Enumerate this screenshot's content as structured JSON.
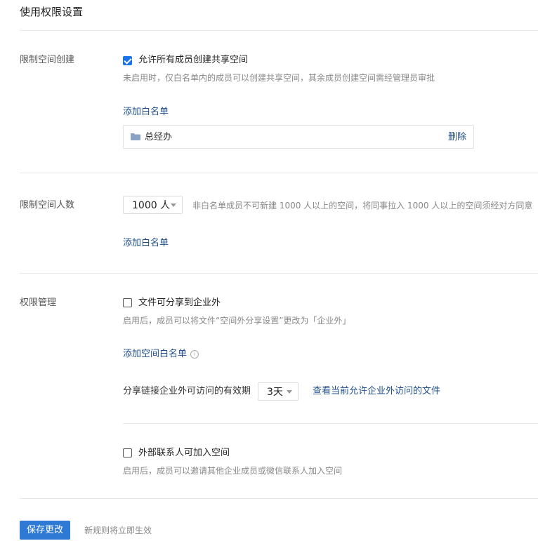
{
  "page": {
    "title": "使用权限设置"
  },
  "space_creation": {
    "label": "限制空间创建",
    "checkbox_label": "允许所有成员创建共享空间",
    "checked": true,
    "hint": "未启用时，仅白名单内的成员可以创建共享空间，其余成员创建空间需经管理员审批",
    "add_whitelist": "添加白名单",
    "whitelist": [
      {
        "name": "总经办",
        "delete_label": "删除",
        "icon": "folder-icon"
      }
    ]
  },
  "member_limit": {
    "label": "限制空间人数",
    "select_value": "1000 人",
    "hint": "非白名单成员不可新建 1000 人以上的空间，将同事拉入 1000 人以上的空间须经对方同意",
    "add_whitelist": "添加白名单"
  },
  "permissions": {
    "label": "权限管理",
    "external_share": {
      "checkbox_label": "文件可分享到企业外",
      "checked": false,
      "hint": "启用后，成员可以将文件“空间外分享设置”更改为「企业外」"
    },
    "add_space_whitelist": "添加空间白名单",
    "link_validity": {
      "label": "分享链接企业外可访问的有效期",
      "select_value": "3天",
      "view_link": "查看当前允许企业外访问的文件"
    },
    "external_contacts": {
      "checkbox_label": "外部联系人可加入空间",
      "checked": false,
      "hint": "启用后，成员可以邀请其他企业成员或微信联系人加入空间"
    }
  },
  "footer": {
    "save_label": "保存更改",
    "note": "新规则将立即生效"
  },
  "colors": {
    "accent": "#2e79d4",
    "link": "#1f4f8a",
    "checkbox": "#1a73e8"
  }
}
